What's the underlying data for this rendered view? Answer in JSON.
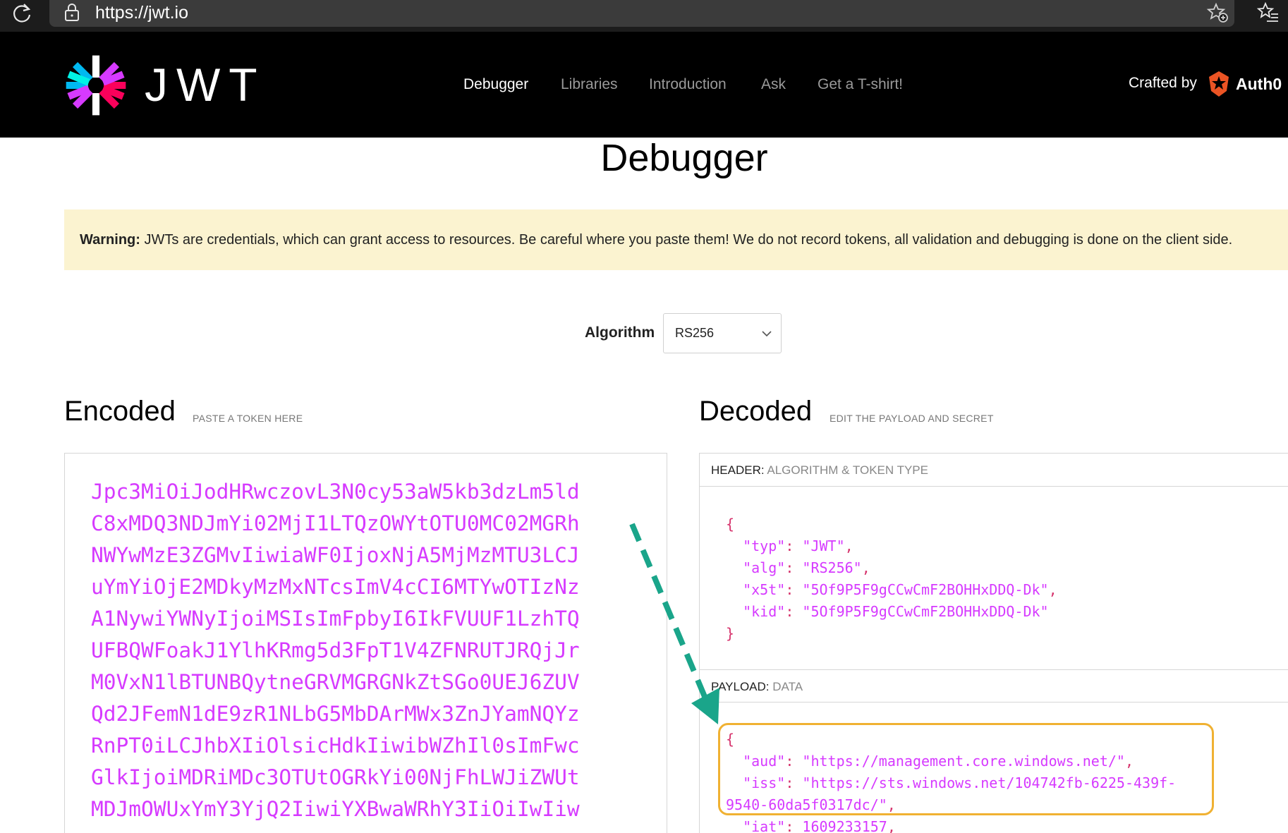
{
  "browser": {
    "url": "https://jwt.io",
    "icons": [
      "reload-icon",
      "lock-icon",
      "add-favorite-icon",
      "favorites-icon"
    ]
  },
  "header": {
    "logo_text": "JWT",
    "nav": [
      {
        "label": "Debugger",
        "active": true
      },
      {
        "label": "Libraries",
        "active": false
      },
      {
        "label": "Introduction",
        "active": false
      },
      {
        "label": "Ask",
        "active": false
      },
      {
        "label": "Get a T-shirt!",
        "active": false
      }
    ],
    "crafted_by": "Crafted by",
    "brand": "Auth0"
  },
  "page": {
    "title": "Debugger",
    "warning": {
      "label": "Warning:",
      "text": "JWTs are credentials, which can grant access to resources. Be careful where you paste them! We do not record tokens, all validation and debugging is done on the client side."
    },
    "algorithm": {
      "label": "Algorithm",
      "selected": "RS256"
    }
  },
  "encoded": {
    "title": "Encoded",
    "subtitle": "PASTE A TOKEN HERE",
    "lines": [
      "Jpc3MiOiJodHRwczovL3N0cy53aW5kb3dzLm5ld",
      "C8xMDQ3NDJmYi02MjI1LTQzOWYtOTU0MC02MGRh",
      "NWYwMzE3ZGMvIiwiaWF0IjoxNjA5MjMzMTU3LCJ",
      "uYmYiOjE2MDkyMzMxNTcsImV4cCI6MTYwOTIzNz",
      "A1NywiYWNyIjoiMSIsImFpbyI6IkFVUUF1LzhTQ",
      "UFBQWFoakJ1YlhKRmg5d3FpT1V4ZFNRUTJRQjJr",
      "M0VxN1lBTUNBQytneGRVMGRGNkZtSGo0UEJ6ZUV",
      "Qd2JFemN1dE9zR1NLbG5MbDArMWx3ZnJYamNQYz",
      "RnPT0iLCJhbXIiOlsicHdkIiwibWZhIl0sImFwc",
      "GlkIjoiMDRiMDc3OTUtOGRkYi00NjFhLWJiZWUt",
      "MDJmOWUxYmY3YjQ2IiwiYXBwaWRhY3IiOiIwIiw"
    ]
  },
  "decoded": {
    "title": "Decoded",
    "subtitle": "EDIT THE PAYLOAD AND SECRET",
    "header_panel": {
      "label": "HEADER:",
      "desc": "ALGORITHM & TOKEN TYPE",
      "open": "{",
      "close": "}",
      "fields": [
        {
          "key": "\"typ\"",
          "value": "\"JWT\"",
          "tail": ","
        },
        {
          "key": "\"alg\"",
          "value": "\"RS256\"",
          "tail": ","
        },
        {
          "key": "\"x5t\"",
          "value": "\"5Of9P5F9gCCwCmF2BOHHxDDQ-Dk\"",
          "tail": ","
        },
        {
          "key": "\"kid\"",
          "value": "\"5Of9P5F9gCCwCmF2BOHHxDDQ-Dk\"",
          "tail": ""
        }
      ]
    },
    "payload_panel": {
      "label": "PAYLOAD:",
      "desc": "DATA",
      "open": "{",
      "aud_key": "\"aud\"",
      "aud_value": "\"https://management.core.windows.net/\"",
      "iss_key": "\"iss\"",
      "iss_value_1": "\"https://sts.windows.net/104742fb-6225-439f-",
      "iss_value_2": "9540-60da5f0317dc/\"",
      "iat_key": "\"iat\"",
      "iat_value": "1609233157"
    }
  },
  "colors": {
    "token": "#d63aff",
    "highlight": "#f0b132",
    "arrow": "#1aa58a",
    "warning_bg": "#fbf3d0"
  }
}
